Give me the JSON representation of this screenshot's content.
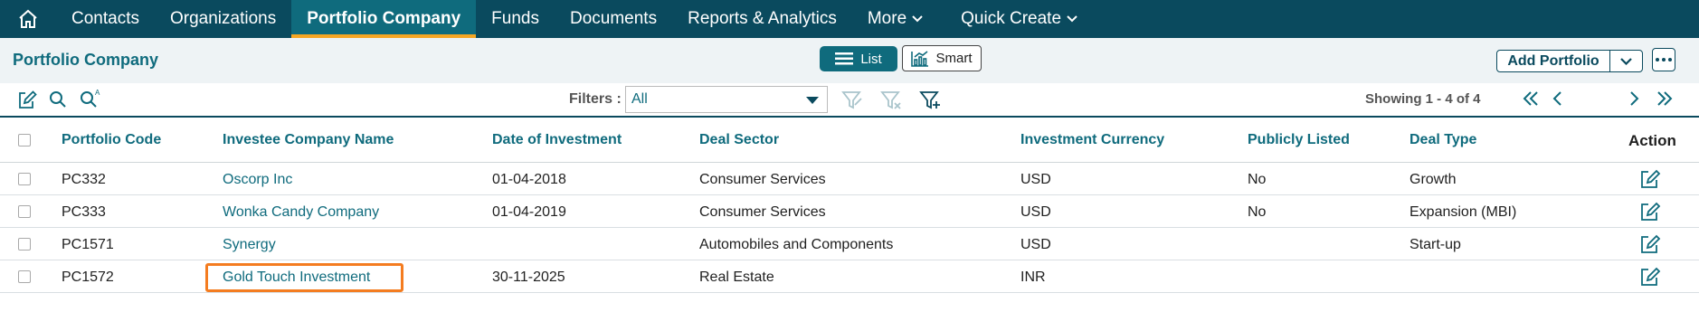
{
  "nav": {
    "items": [
      {
        "label": "Contacts",
        "name": "nav-contacts",
        "active": false
      },
      {
        "label": "Organizations",
        "name": "nav-organizations",
        "active": false
      },
      {
        "label": "Portfolio Company",
        "name": "nav-portfolio-company",
        "active": true
      },
      {
        "label": "Funds",
        "name": "nav-funds",
        "active": false
      },
      {
        "label": "Documents",
        "name": "nav-documents",
        "active": false
      },
      {
        "label": "Reports & Analytics",
        "name": "nav-reports-analytics",
        "active": false
      },
      {
        "label": "More",
        "name": "nav-more",
        "active": false,
        "dropdown": true
      },
      {
        "label": "Quick Create",
        "name": "nav-quick-create",
        "active": false,
        "dropdown": true
      }
    ]
  },
  "page": {
    "title": "Portfolio Company",
    "view_list_label": "List",
    "view_smart_label": "Smart",
    "add_button_label": "Add Portfolio"
  },
  "toolbar": {
    "filters_label": "Filters :",
    "filters_value": "All",
    "showing": "Showing 1 - 4 of 4"
  },
  "table": {
    "columns": [
      "Portfolio Code",
      "Investee Company Name",
      "Date of Investment",
      "Deal Sector",
      "Investment Currency",
      "Publicly Listed",
      "Deal Type",
      "Action"
    ],
    "rows": [
      {
        "code": "PC332",
        "company": "Oscorp Inc",
        "date": "01-04-2018",
        "sector": "Consumer Services",
        "currency": "USD",
        "listed": "No",
        "deal_type": "Growth"
      },
      {
        "code": "PC333",
        "company": "Wonka Candy Company",
        "date": "01-04-2019",
        "sector": "Consumer Services",
        "currency": "USD",
        "listed": "No",
        "deal_type": "Expansion (MBI)"
      },
      {
        "code": "PC1571",
        "company": "Synergy",
        "date": "",
        "sector": "Automobiles and Components",
        "currency": "USD",
        "listed": "",
        "deal_type": "Start-up"
      },
      {
        "code": "PC1572",
        "company": "Gold Touch Investment",
        "date": "30-11-2025",
        "sector": "Real Estate",
        "currency": "INR",
        "listed": "",
        "deal_type": ""
      }
    ],
    "highlighted_row": 3
  },
  "colors": {
    "nav_bg": "#0a4a5e",
    "accent": "#0f6b7d",
    "active_underline": "#f5a623",
    "highlight_border": "#f47c20"
  },
  "icons": [
    "home-icon",
    "chevron-down-icon",
    "list-icon",
    "chart-icon",
    "edit-icon",
    "search-icon",
    "advanced-search-icon",
    "filter-icon",
    "clear-filter-icon",
    "add-filter-icon",
    "first-page-icon",
    "prev-page-icon",
    "next-page-icon",
    "last-page-icon",
    "more-dots-icon"
  ]
}
